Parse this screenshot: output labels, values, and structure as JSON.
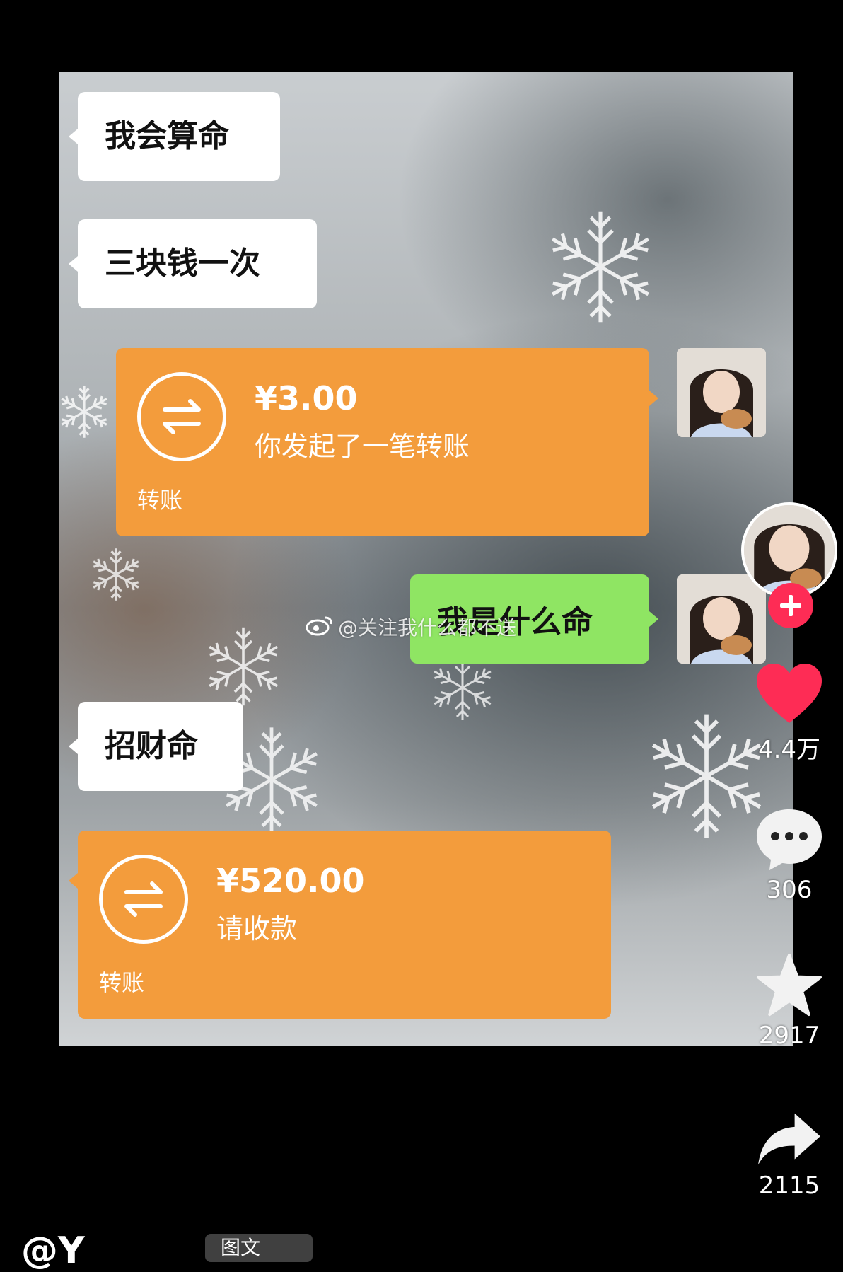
{
  "chat": {
    "messages": [
      {
        "side": "left",
        "type": "text",
        "text": "我会算命"
      },
      {
        "side": "left",
        "type": "text",
        "text": "三块钱一次"
      },
      {
        "side": "right",
        "type": "transfer",
        "amount": "¥3.00",
        "desc": "你发起了一笔转账",
        "footer": "转账"
      },
      {
        "side": "right",
        "type": "text",
        "text": "我是什么命"
      },
      {
        "side": "left",
        "type": "text",
        "text": "招财命"
      },
      {
        "side": "left",
        "type": "transfer",
        "amount": "¥520.00",
        "desc": "请收款",
        "footer": "转账"
      }
    ]
  },
  "watermark": {
    "text": "@关注我什么都不送",
    "icon": "weibo-icon"
  },
  "sidebar": {
    "likes": "4.4万",
    "comments": "306",
    "favorites": "2917",
    "shares": "2115"
  },
  "caption": {
    "author": "@Y",
    "badge": "图文"
  },
  "colors": {
    "transfer": "#f39c3c",
    "my_bubble": "#8fe563",
    "like": "#fe2c55",
    "background": "#000000"
  }
}
